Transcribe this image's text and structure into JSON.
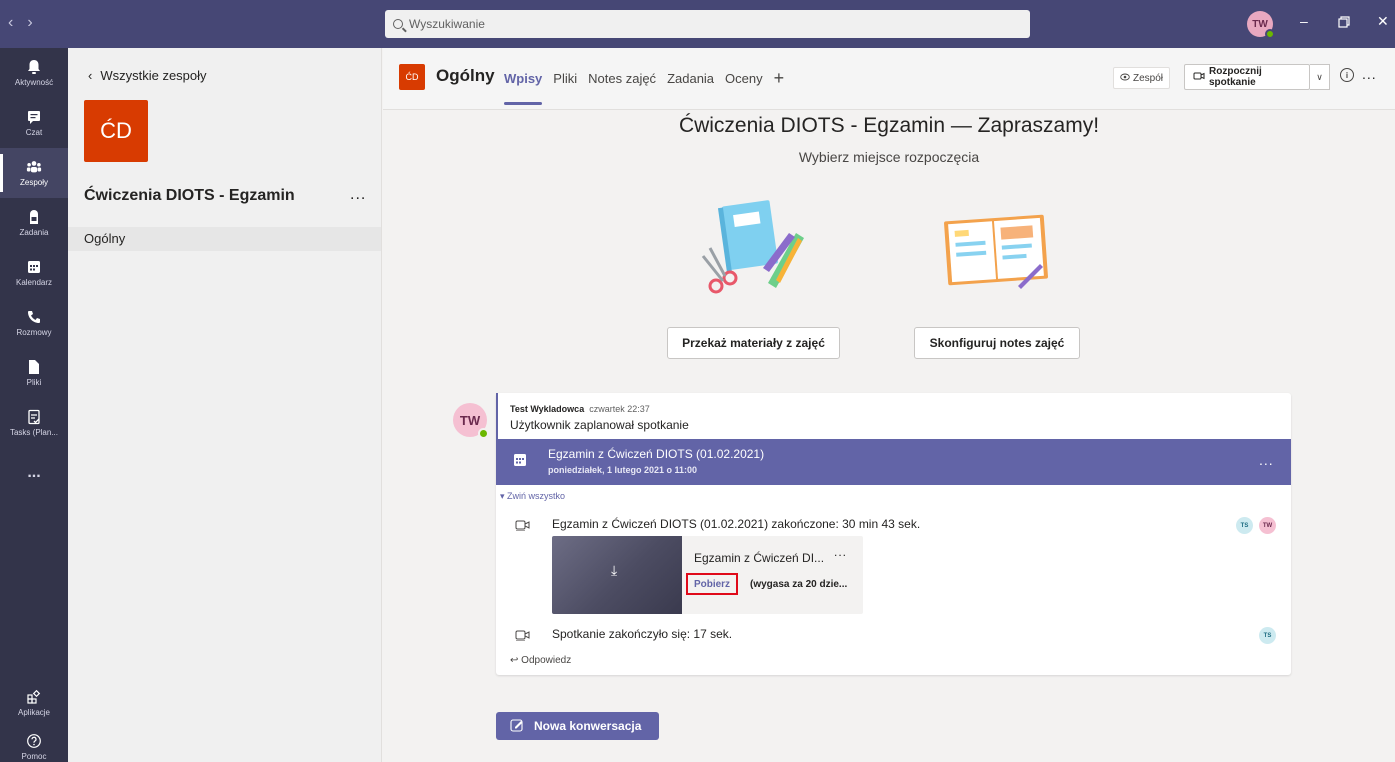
{
  "titlebar": {
    "search_placeholder": "Wyszukiwanie",
    "user_initials": "TW"
  },
  "rail": {
    "items": [
      {
        "label": "Aktywność",
        "icon": "bell-icon"
      },
      {
        "label": "Czat",
        "icon": "chat-icon"
      },
      {
        "label": "Zespoły",
        "icon": "teams-icon"
      },
      {
        "label": "Zadania",
        "icon": "assignments-icon"
      },
      {
        "label": "Kalendarz",
        "icon": "calendar-icon"
      },
      {
        "label": "Rozmowy",
        "icon": "phone-icon"
      },
      {
        "label": "Pliki",
        "icon": "file-icon"
      },
      {
        "label": "Tasks (Plan...",
        "icon": "tasks-icon"
      }
    ],
    "more_label": "...",
    "apps_label": "Aplikacje",
    "help_label": "Pomoc"
  },
  "teampanel": {
    "back_label": "Wszystkie zespoły",
    "tile_initials": "ĆD",
    "team_name": "Ćwiczenia DIOTS - Egzamin",
    "more": "...",
    "channels": [
      "Ogólny"
    ]
  },
  "channel": {
    "tile_initials": "ĆD",
    "name": "Ogólny",
    "tabs": [
      "Wpisy",
      "Pliki",
      "Notes zajęć",
      "Zadania",
      "Oceny"
    ],
    "add_tab": "+",
    "team_label": "Zespół",
    "meet_label": "Rozpocznij spotkanie",
    "more": "..."
  },
  "welcome": {
    "title": "Ćwiczenia DIOTS - Egzamin — Zapraszamy!",
    "subtitle": "Wybierz miejsce rozpoczęcia",
    "cards": [
      {
        "label": "Przekaż materiały z zajęć",
        "icon": "class-materials-illustration"
      },
      {
        "label": "Skonfiguruj notes zajęć",
        "icon": "class-notebook-illustration"
      }
    ]
  },
  "post": {
    "author_initials": "TW",
    "author": "Test Wykladowca",
    "time": "czwartek 22:37",
    "text": "Użytkownik zaplanował spotkanie",
    "meeting": {
      "title": "Egzamin z Ćwiczeń DIOTS (01.02.2021)",
      "date": "poniedziałek, 1 lutego 2021 o 11:00",
      "more": "..."
    },
    "collapse_label": "Zwiń wszystko",
    "events": [
      {
        "text": "Egzamin z Ćwiczeń DIOTS (01.02.2021) zakończone: 30 min 43 sek.",
        "participants": [
          "TS",
          "TW"
        ]
      },
      {
        "text": "Spotkanie zakończyło się: 17 sek.",
        "participants": [
          "TS"
        ]
      }
    ],
    "recording": {
      "title": "Egzamin z Ćwiczeń DI...",
      "more": "...",
      "download_label": "Pobierz",
      "expires": "(wygasa za 20 dzie..."
    },
    "reply_label": "Odpowiedz"
  },
  "new_conversation_label": "Nowa konwersacja",
  "colors": {
    "brand": "#6264a7",
    "titlebar": "#464775",
    "rail": "#33344a",
    "team_tile": "#d83b01",
    "highlight": "#e00a1a"
  }
}
